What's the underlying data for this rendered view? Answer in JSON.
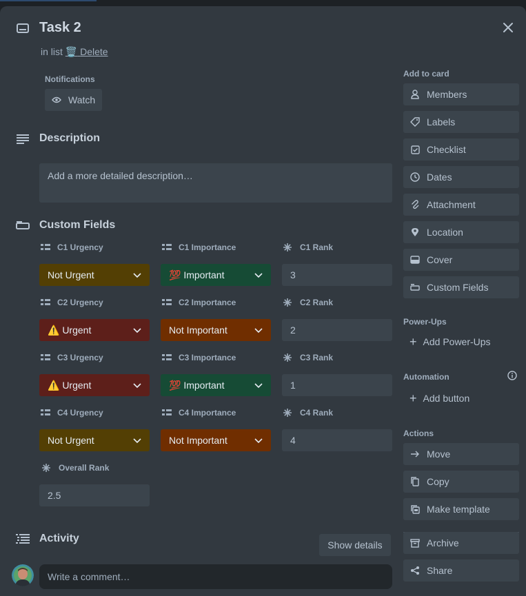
{
  "card": {
    "title": "Task 2",
    "in_list_prefix": "in list",
    "delete_emoji": "🗑️",
    "delete_label": "Delete"
  },
  "notifications": {
    "label": "Notifications",
    "watch_label": "Watch"
  },
  "description": {
    "heading": "Description",
    "placeholder": "Add a more detailed description…"
  },
  "custom_fields": {
    "heading": "Custom Fields",
    "fields": [
      {
        "label": "C1 Urgency",
        "value": "Not Urgent",
        "color": "#533f04"
      },
      {
        "label": "C1 Importance",
        "value": "💯 Important",
        "color": "#164b35"
      },
      {
        "label": "C1 Rank",
        "value": "3"
      },
      {
        "label": "C2 Urgency",
        "value": "⚠️ Urgent",
        "color": "#5d1f1a"
      },
      {
        "label": "C2 Importance",
        "value": "Not Important",
        "color": "#702e00"
      },
      {
        "label": "C2 Rank",
        "value": "2"
      },
      {
        "label": "C3 Urgency",
        "value": "⚠️ Urgent",
        "color": "#5d1f1a"
      },
      {
        "label": "C3 Importance",
        "value": "💯 Important",
        "color": "#164b35"
      },
      {
        "label": "C3 Rank",
        "value": "1"
      },
      {
        "label": "C4 Urgency",
        "value": "Not Urgent",
        "color": "#533f04"
      },
      {
        "label": "C4 Importance",
        "value": "Not Important",
        "color": "#702e00"
      },
      {
        "label": "C4 Rank",
        "value": "4"
      },
      {
        "label": "Overall Rank",
        "value": "2.5"
      }
    ]
  },
  "activity": {
    "heading": "Activity",
    "show_details": "Show details",
    "comment_placeholder": "Write a comment…"
  },
  "sidebar": {
    "add_to_card_label": "Add to card",
    "add_to_card": [
      {
        "label": "Members",
        "icon": "person-icon"
      },
      {
        "label": "Labels",
        "icon": "tag-icon"
      },
      {
        "label": "Checklist",
        "icon": "checklist-icon"
      },
      {
        "label": "Dates",
        "icon": "clock-icon"
      },
      {
        "label": "Attachment",
        "icon": "paperclip-icon"
      },
      {
        "label": "Location",
        "icon": "location-pin-icon"
      },
      {
        "label": "Cover",
        "icon": "cover-icon"
      },
      {
        "label": "Custom Fields",
        "icon": "custom-fields-icon"
      }
    ],
    "power_ups_label": "Power-Ups",
    "add_power_ups": "Add Power-Ups",
    "automation_label": "Automation",
    "add_button": "Add button",
    "actions_label": "Actions",
    "actions": [
      {
        "label": "Move",
        "icon": "arrow-right-icon"
      },
      {
        "label": "Copy",
        "icon": "copy-icon"
      },
      {
        "label": "Make template",
        "icon": "template-icon"
      },
      {
        "label": "Archive",
        "icon": "archive-icon"
      },
      {
        "label": "Share",
        "icon": "share-icon"
      }
    ]
  }
}
